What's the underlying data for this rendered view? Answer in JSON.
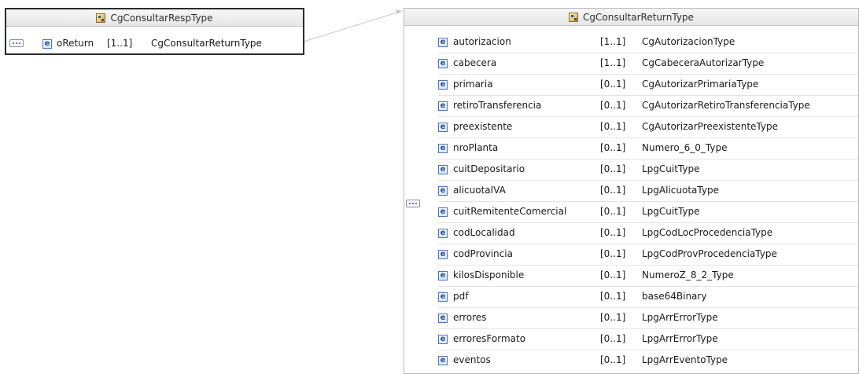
{
  "left_type": {
    "title": "CgConsultarRespType",
    "icon": "complex-type-icon",
    "element": {
      "name": "oReturn",
      "cardinality": "[1..1]",
      "type": "CgConsultarReturnType",
      "icon": "element-icon"
    }
  },
  "right_type": {
    "title": "CgConsultarReturnType",
    "icon": "complex-type-icon",
    "rows": [
      {
        "name": "autorizacion",
        "cardinality": "[1..1]",
        "type": "CgAutorizacionType"
      },
      {
        "name": "cabecera",
        "cardinality": "[1..1]",
        "type": "CgCabeceraAutorizarType"
      },
      {
        "name": "primaria",
        "cardinality": "[0..1]",
        "type": "CgAutorizarPrimariaType"
      },
      {
        "name": "retiroTransferencia",
        "cardinality": "[0..1]",
        "type": "CgAutorizarRetiroTransferenciaType"
      },
      {
        "name": "preexistente",
        "cardinality": "[0..1]",
        "type": "CgAutorizarPreexistenteType"
      },
      {
        "name": "nroPlanta",
        "cardinality": "[0..1]",
        "type": "Numero_6_0_Type"
      },
      {
        "name": "cuitDepositario",
        "cardinality": "[0..1]",
        "type": "LpgCuitType"
      },
      {
        "name": "alicuotaIVA",
        "cardinality": "[0..1]",
        "type": "LpgAlicuotaType"
      },
      {
        "name": "cuitRemitenteComercial",
        "cardinality": "[0..1]",
        "type": "LpgCuitType"
      },
      {
        "name": "codLocalidad",
        "cardinality": "[0..1]",
        "type": "LpgCodLocProcedenciaType"
      },
      {
        "name": "codProvincia",
        "cardinality": "[0..1]",
        "type": "LpgCodProvProcedenciaType"
      },
      {
        "name": "kilosDisponible",
        "cardinality": "[0..1]",
        "type": "NumeroZ_8_2_Type"
      },
      {
        "name": "pdf",
        "cardinality": "[0..1]",
        "type": "base64Binary"
      },
      {
        "name": "errores",
        "cardinality": "[0..1]",
        "type": "LpgArrErrorType"
      },
      {
        "name": "erroresFormato",
        "cardinality": "[0..1]",
        "type": "LpgArrErrorType"
      },
      {
        "name": "eventos",
        "cardinality": "[0..1]",
        "type": "LpgArrEventoType"
      }
    ]
  },
  "colors": {
    "left_border": "#2b2b2b",
    "right_border": "#b9b9b9",
    "title_bar_start": "#f7f7f7",
    "title_bar_end": "#e6e6e6",
    "element_icon": "#4b74b8",
    "connector": "#c7c7c7"
  }
}
